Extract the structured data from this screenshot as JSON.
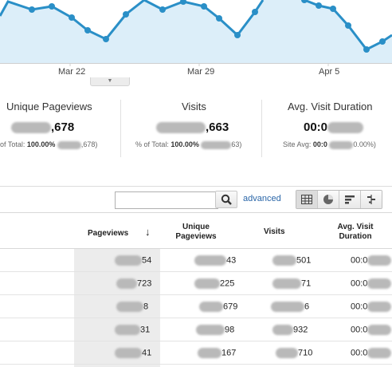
{
  "trend_chart": {
    "x_labels": [
      "Mar 22",
      "Mar 29",
      "Apr 5"
    ],
    "line_color": "#2a8fc7",
    "fill_color": "#dceef9"
  },
  "collapse_toggle_icon": "chevron-down-icon",
  "scorecards": [
    {
      "title": "Unique Pageviews",
      "value": ",678",
      "sub_prefix": "of Total: ",
      "sub_bold": "100.00%",
      "sub_tail": ",678)"
    },
    {
      "title": "Visits",
      "value": ",663",
      "sub_prefix": "% of Total: ",
      "sub_bold": "100.00%",
      "sub_tail": "63)"
    },
    {
      "title": "Avg. Visit Duration",
      "value": "00:0",
      "sub_prefix": "Site Avg: ",
      "sub_bold": "00:0",
      "sub_tail": "0.00%)"
    }
  ],
  "toolbar": {
    "search_placeholder": "",
    "search_icon": "magnifier-icon",
    "advanced_label": "advanced",
    "view_icons": [
      "table-view-icon",
      "pie-view-icon",
      "performance-view-icon",
      "comparison-view-icon"
    ]
  },
  "table": {
    "headers": {
      "pageviews": "Pageviews",
      "sort_arrow": "↓",
      "unique_pageviews_1": "Unique",
      "unique_pageviews_2": "Pageviews",
      "visits": "Visits",
      "duration_1": "Avg. Visit",
      "duration_2": "Duration"
    },
    "rows": [
      {
        "pageviews": "54",
        "unique": "43",
        "visits": "501",
        "duration": "00:0"
      },
      {
        "pageviews": "723",
        "unique": "225",
        "visits": "71",
        "duration": "00:0"
      },
      {
        "pageviews": "8",
        "unique": "679",
        "visits": "6",
        "duration": "00:0"
      },
      {
        "pageviews": "31",
        "unique": "98",
        "visits": "932",
        "duration": "00:0"
      },
      {
        "pageviews": "41",
        "unique": "167",
        "visits": "710",
        "duration": "00:0"
      }
    ]
  }
}
